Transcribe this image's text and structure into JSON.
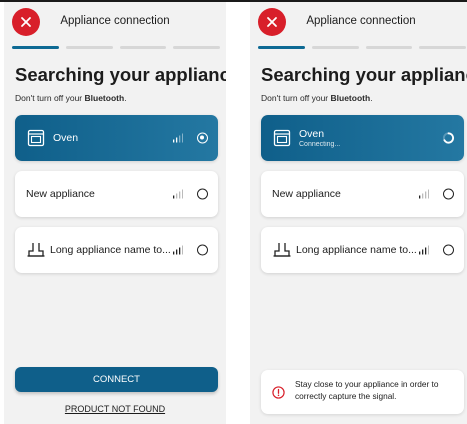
{
  "colors": {
    "accent": "#0f5f8a",
    "close_red": "#d81f2a",
    "warning_red": "#d81f2a",
    "inactive_segment": "#d7d7d7"
  },
  "steps": {
    "total": 4,
    "current": 1
  },
  "screens": [
    {
      "header": {
        "title": "Appliance connection",
        "close_icon": "close-icon"
      },
      "headline": "Searching your appliance",
      "subline_prefix": "Don't turn off your ",
      "subline_bold": "Bluetooth",
      "subline_suffix": ".",
      "appliances": [
        {
          "name": "Oven",
          "icon": "oven-icon",
          "signal_icon": "signal-strength-icon",
          "state": "selected"
        },
        {
          "name": "New appliance",
          "icon": "",
          "signal_icon": "signal-strength-icon",
          "state": "unselected"
        },
        {
          "name": "Long appliance name to...",
          "icon": "hood-icon",
          "signal_icon": "signal-strength-icon",
          "state": "unselected"
        }
      ],
      "connect_label": "CONNECT",
      "not_found_label": "PRODUCT NOT FOUND"
    },
    {
      "header": {
        "title": "Appliance connection",
        "close_icon": "close-icon"
      },
      "headline": "Searching your appliance",
      "subline_prefix": "Don't turn off your ",
      "subline_bold": "Bluetooth",
      "subline_suffix": ".",
      "appliances": [
        {
          "name": "Oven",
          "status": "Connecting...",
          "icon": "oven-icon",
          "state": "connecting",
          "status_icon": "loading-spinner-icon"
        },
        {
          "name": "New appliance",
          "icon": "",
          "signal_icon": "signal-strength-icon",
          "state": "unselected"
        },
        {
          "name": "Long appliance name to...",
          "icon": "hood-icon",
          "signal_icon": "signal-strength-icon",
          "state": "unselected"
        }
      ],
      "notice": {
        "icon": "warning-icon",
        "text": "Stay close to your appliance in order to correctly capture the signal."
      }
    }
  ]
}
